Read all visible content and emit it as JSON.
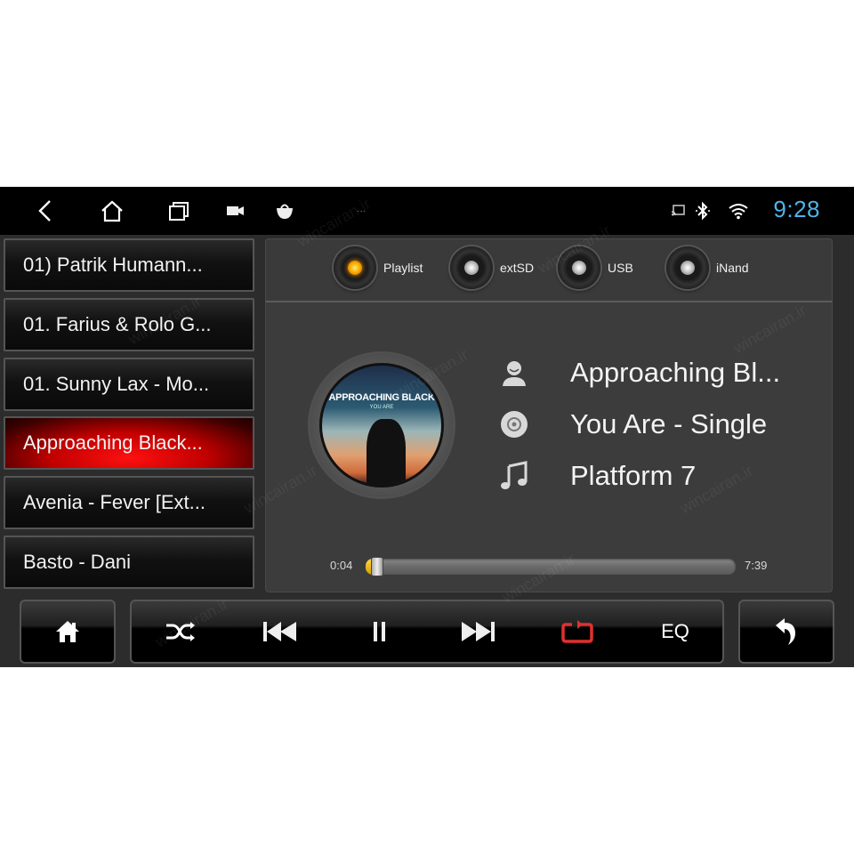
{
  "status_bar": {
    "nav_icons": [
      "back-icon",
      "home-icon",
      "recents-icon",
      "camera-icon",
      "store-bag-icon",
      "more-dots-icon"
    ],
    "status_icons": [
      "cast-icon",
      "bluetooth-icon",
      "wifi-icon"
    ],
    "time": "9:28",
    "time_color": "#4fb4e6"
  },
  "playlist": {
    "items": [
      {
        "label": "01) Patrik Humann...",
        "active": false
      },
      {
        "label": "01. Farius & Rolo G...",
        "active": false
      },
      {
        "label": "01. Sunny Lax - Mo...",
        "active": false
      },
      {
        "label": "Approaching Black...",
        "active": true
      },
      {
        "label": "Avenia - Fever [Ext...",
        "active": false
      },
      {
        "label": "Basto - Dani",
        "active": false
      }
    ],
    "active_color": "#e00000"
  },
  "sources": [
    {
      "label": "Playlist",
      "selected": true
    },
    {
      "label": "extSD",
      "selected": false
    },
    {
      "label": "USB",
      "selected": false
    },
    {
      "label": "iNand",
      "selected": false
    }
  ],
  "now_playing": {
    "artwork": {
      "title": "APPROACHING BLACK",
      "subtitle": "YOU ARE"
    },
    "artist": "Approaching Bl...",
    "album": "You Are - Single",
    "title": "Platform 7",
    "icons": [
      "artist-icon",
      "album-disc-icon",
      "music-note-icon"
    ]
  },
  "progress": {
    "elapsed": "0:04",
    "total": "7:39",
    "fraction": 0.009
  },
  "controls": {
    "home_icon": "home-icon",
    "buttons": [
      "shuffle-icon",
      "previous-icon",
      "pause-icon",
      "next-icon",
      "repeat-icon"
    ],
    "eq_label": "EQ",
    "back_icon": "back-arrow-icon",
    "repeat_color": "#e03030"
  },
  "watermark": "wincairan.ir"
}
